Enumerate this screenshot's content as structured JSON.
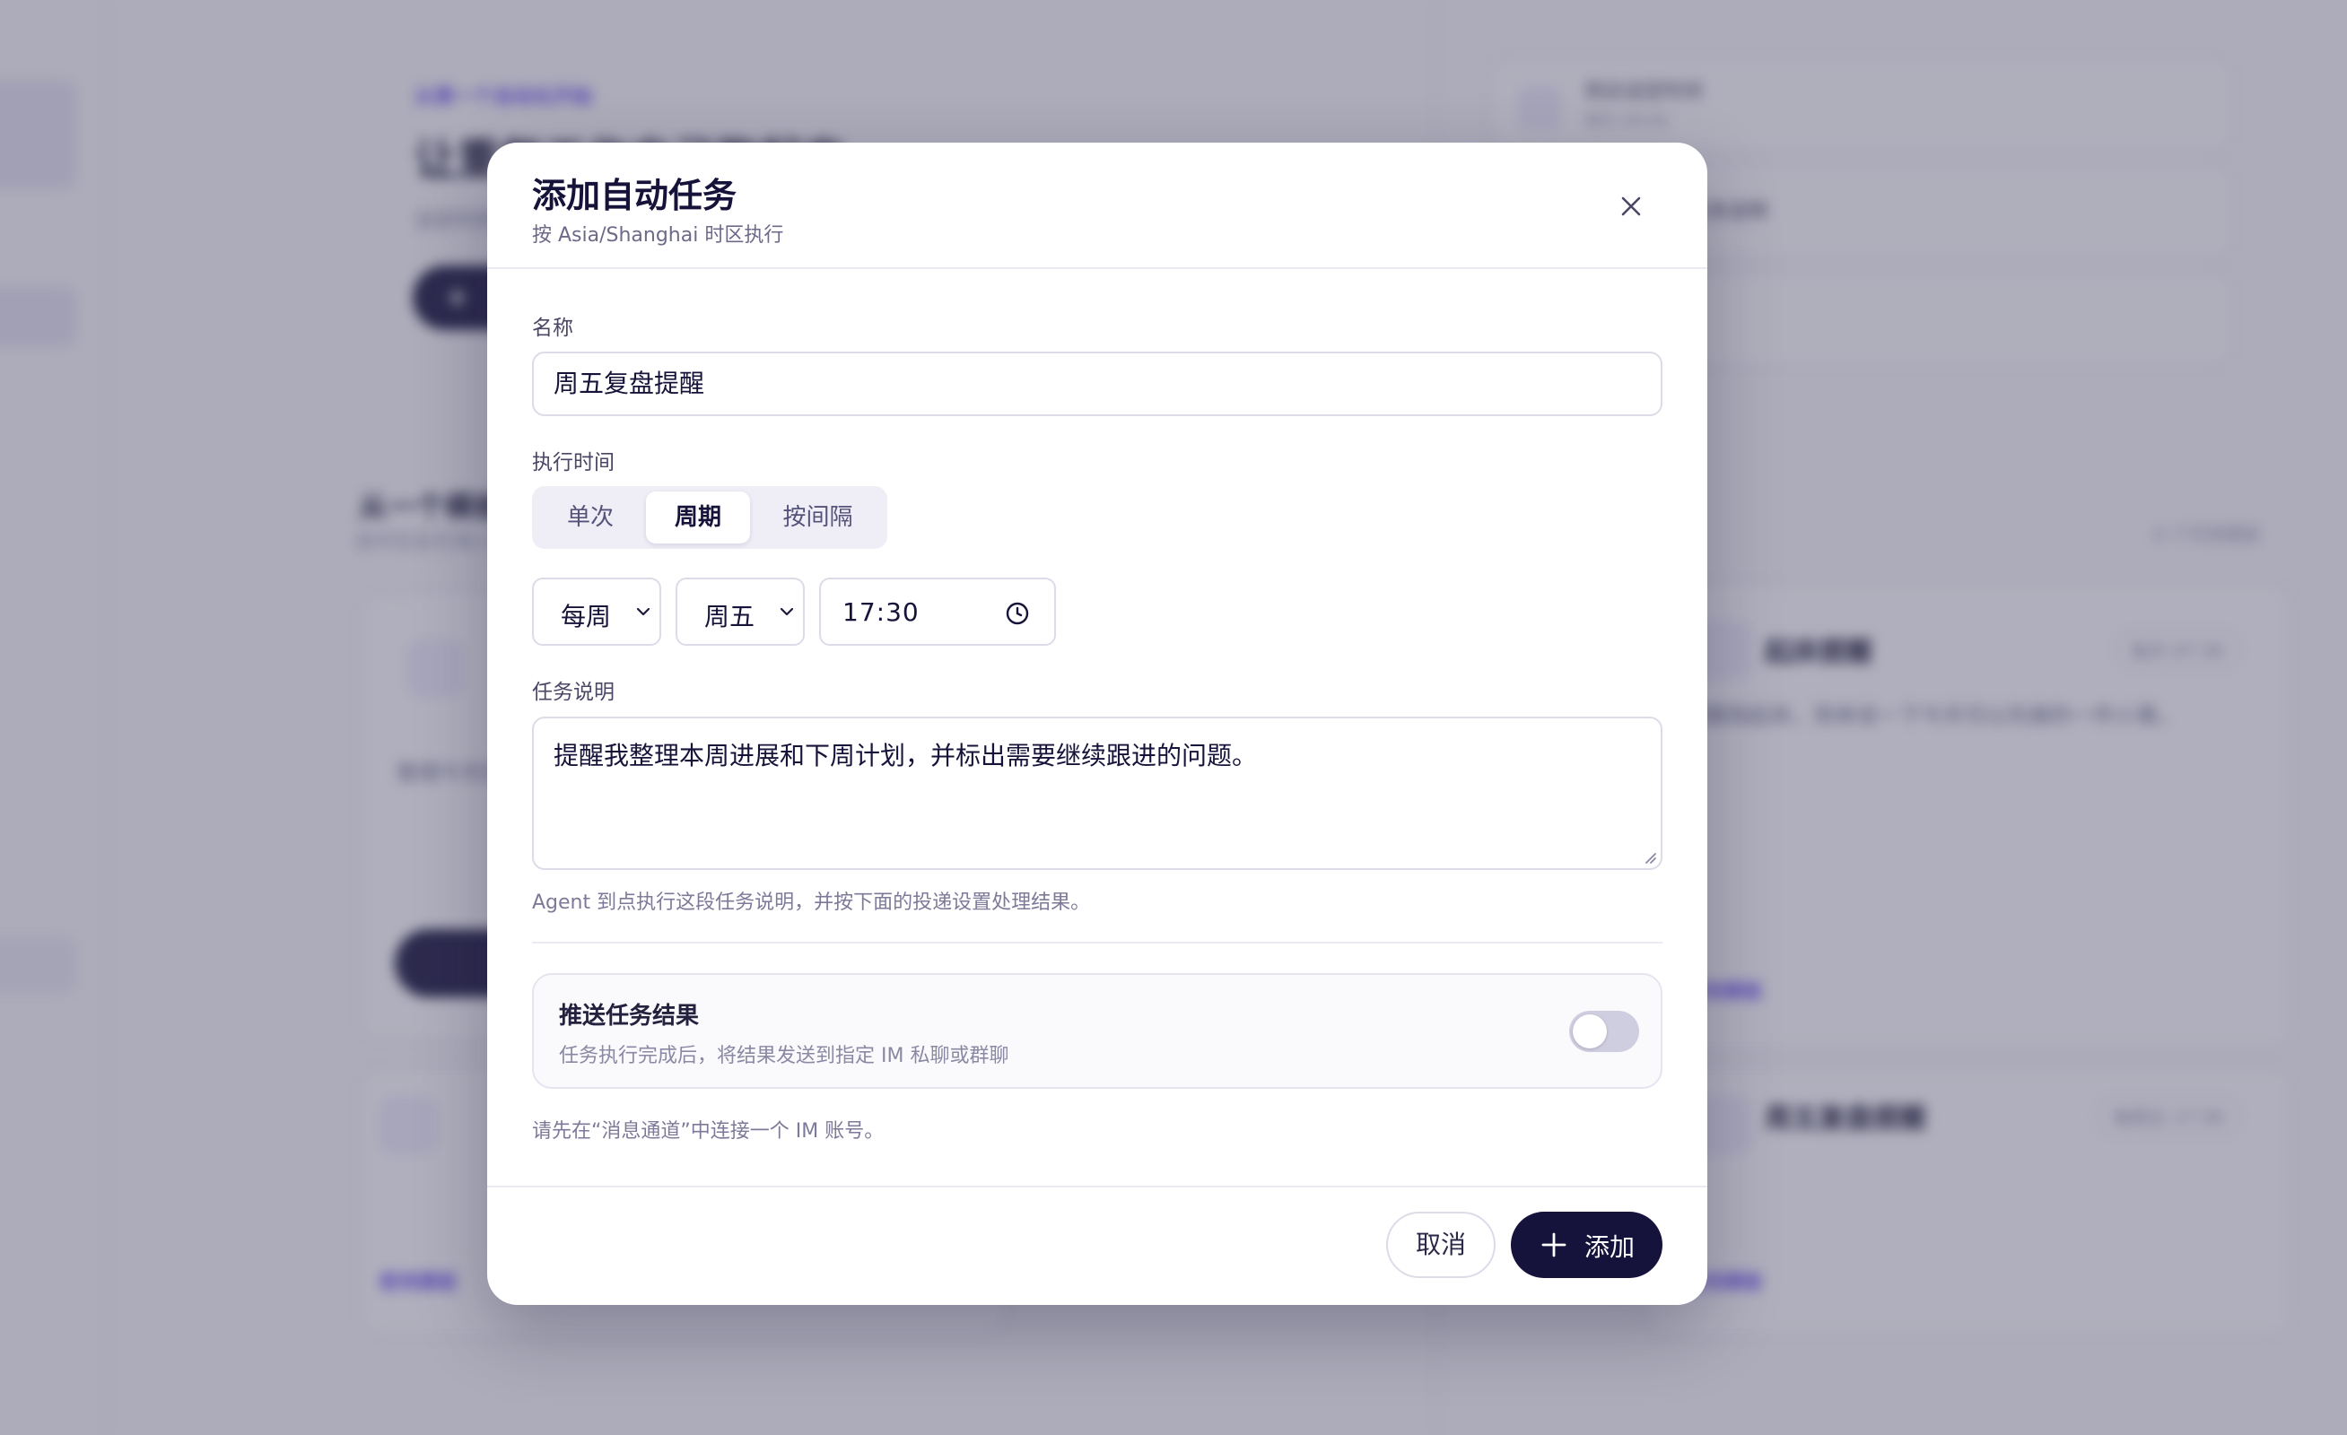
{
  "background": {
    "eyebrow": "从第一个自动化开始",
    "headline": "让重复工作自己跑起来",
    "subtitle": "设定时间和任务说明，Agent 会按时执行。",
    "section_title": "从一个模板开始",
    "section_subtitle": "选中后会先填入表单，你可以再修改。",
    "template_count": "4 个可用模板",
    "right_items": [
      {
        "title": "到达设定时间",
        "sub": "每天 09:00"
      },
      {
        "title": "Agent 执行任务说明",
        "sub": ""
      },
      {
        "title": "",
        "sub": ""
      }
    ],
    "cards": [
      {
        "title": "起床提醒",
        "badge": "每天 07:30",
        "text": "提醒我起床，简单说一下今天可以先做的一件小事。",
        "link": "使用模板"
      },
      {
        "title": "周五复盘提醒",
        "badge": "每周五 17:30",
        "text": "提醒我整理本周进展和下周计划，并标出需要继续跟进的问题。",
        "link": "使用模板"
      }
    ],
    "left_card_text": "整理今天的资料，并给出下一步行动。",
    "left_link": "使用模板"
  },
  "modal": {
    "title": "添加自动任务",
    "subtitle": "按 Asia/Shanghai 时区执行",
    "name_label": "名称",
    "name_value": "周五复盘提醒",
    "time_label": "执行时间",
    "schedule_tabs": [
      {
        "label": "单次",
        "active": false
      },
      {
        "label": "周期",
        "active": true
      },
      {
        "label": "按间隔",
        "active": false
      }
    ],
    "frequency": "每周",
    "weekday": "周五",
    "time": "17:30",
    "desc_label": "任务说明",
    "desc_value": "提醒我整理本周进展和下周计划，并标出需要继续跟进的问题。",
    "desc_hint": "Agent 到点执行这段任务说明，并按下面的投递设置处理结果。",
    "push_title": "推送任务结果",
    "push_sub": "任务执行完成后，将结果发送到指定 IM 私聊或群聊",
    "push_enabled": false,
    "im_hint": "请先在“消息通道”中连接一个 IM 账号。",
    "cancel_label": "取消",
    "add_label": "添加"
  },
  "colors": {
    "primary": "#15123b",
    "accent": "#6b4ff0",
    "toggle_off": "#cfcde0"
  }
}
